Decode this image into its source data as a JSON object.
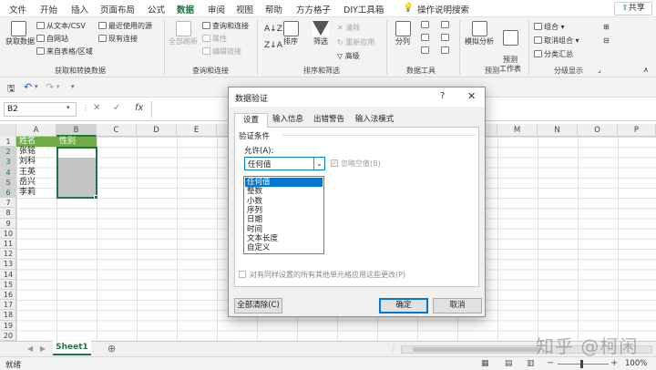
{
  "menu": {
    "items": [
      "文件",
      "开始",
      "插入",
      "页面布局",
      "公式",
      "数据",
      "审阅",
      "视图",
      "帮助",
      "方方格子",
      "DIY工具箱"
    ],
    "active": "数据",
    "search_label": "操作说明搜索",
    "share_label": "共享"
  },
  "ribbon": {
    "get_data": {
      "label": "获取数据",
      "text_csv": "从文本/CSV",
      "from_web": "自网站",
      "from_table": "来自表格/区域",
      "recent": "最近使用的源",
      "existing": "现有连接",
      "group": "获取和转换数据"
    },
    "queries": {
      "refresh_all": "全部刷新",
      "queries_conn": "查询和连接",
      "properties": "属性",
      "edit_links": "编辑链接",
      "group": "查询和连接"
    },
    "sort_filter": {
      "sort": "排序",
      "filter": "筛选",
      "clear": "清除",
      "reapply": "重新应用",
      "advanced": "高级",
      "group": "排序和筛选"
    },
    "data_tools": {
      "split": "分列",
      "group": "数据工具"
    },
    "forecast": {
      "whatif": "模拟分析",
      "forecast_sheet": "预测\n工作表",
      "group": "预测"
    },
    "outline": {
      "group_btn": "组合",
      "ungroup": "取消组合",
      "subtotal": "分类汇总",
      "group": "分级显示"
    }
  },
  "formula": {
    "name_box": "B2",
    "fx": "fx"
  },
  "grid": {
    "columns": [
      "A",
      "B",
      "C",
      "D",
      "E",
      "F",
      "G",
      "H",
      "I",
      "J",
      "K",
      "L",
      "M",
      "N",
      "O",
      "P"
    ],
    "rows": [
      "1",
      "2",
      "3",
      "4",
      "5",
      "6",
      "7",
      "8",
      "9",
      "10",
      "11",
      "12",
      "13",
      "14",
      "15",
      "16",
      "17",
      "18",
      "19",
      "20"
    ],
    "header_row": [
      "姓名",
      "性别"
    ],
    "names": [
      "张铭",
      "刘科",
      "王英",
      "岳兴",
      "李莉"
    ]
  },
  "sheet": {
    "tab": "Sheet1"
  },
  "status": {
    "ready": "就绪",
    "zoom": "100%"
  },
  "dialog": {
    "title": "数据验证",
    "help": "?",
    "tabs": [
      "设置",
      "输入信息",
      "出错警告",
      "输入法模式"
    ],
    "section": "验证条件",
    "allow_label": "允许(A):",
    "allow_value": "任何值",
    "ignore_blank": "忽略空值(B)",
    "options": [
      "任何值",
      "整数",
      "小数",
      "序列",
      "日期",
      "时间",
      "文本长度",
      "自定义"
    ],
    "apply_all": "对有同样设置的所有其他单元格应用这些更改(P)",
    "clear_all": "全部清除(C)",
    "ok": "确定",
    "cancel": "取消"
  },
  "watermark": "知乎 @柯闲",
  "colors": {
    "accent": "#217346",
    "select": "#0078d7",
    "grey_fill": "#c4c4c4"
  }
}
